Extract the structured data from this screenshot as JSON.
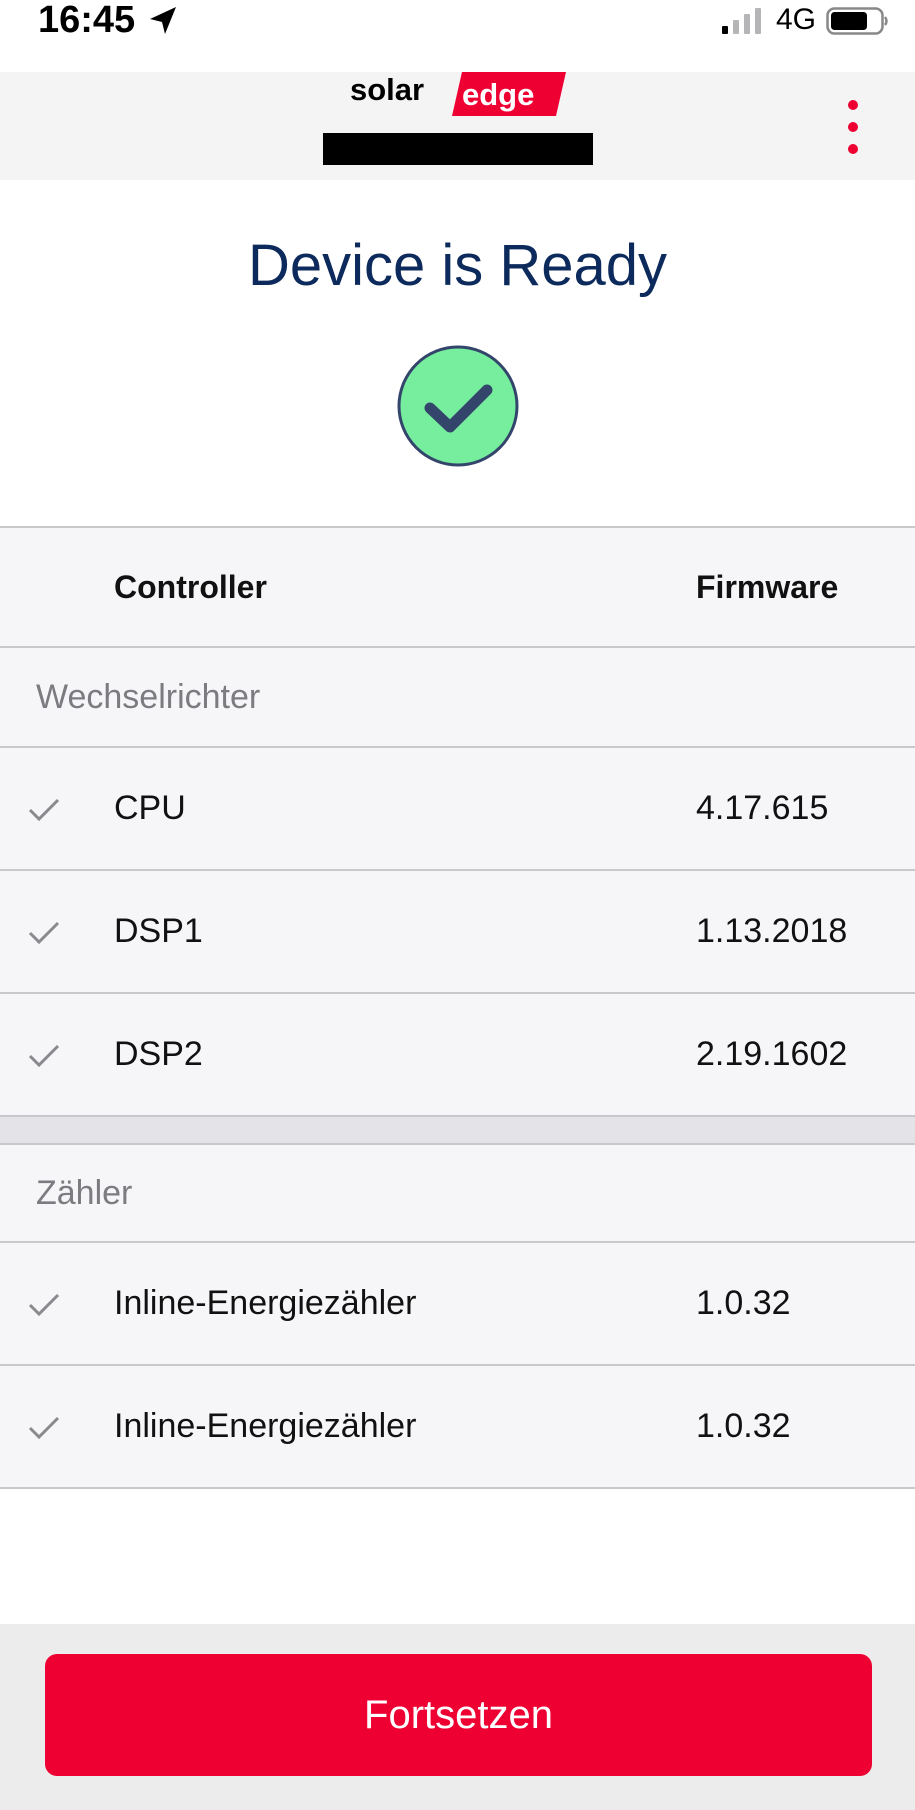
{
  "status_bar": {
    "time": "16:45",
    "network": "4G"
  },
  "header": {
    "logo_text_left": "solar",
    "logo_text_right": "edge",
    "brand_color": "#ee0033"
  },
  "ready": {
    "title": "Device is Ready",
    "icon": "check-circle-icon",
    "icon_color": "#76ee9e"
  },
  "table": {
    "col_controller": "Controller",
    "col_firmware": "Firmware",
    "sections": [
      {
        "label": "Wechselrichter",
        "items": [
          {
            "name": "CPU",
            "firmware": "4.17.615"
          },
          {
            "name": "DSP1",
            "firmware": "1.13.2018"
          },
          {
            "name": "DSP2",
            "firmware": "2.19.1602"
          }
        ]
      },
      {
        "label": "Zähler",
        "items": [
          {
            "name": "Inline-Energiezähler",
            "firmware": "1.0.32"
          },
          {
            "name": "Inline-Energiezähler",
            "firmware": "1.0.32"
          }
        ]
      }
    ]
  },
  "footer": {
    "continue_label": "Fortsetzen"
  }
}
